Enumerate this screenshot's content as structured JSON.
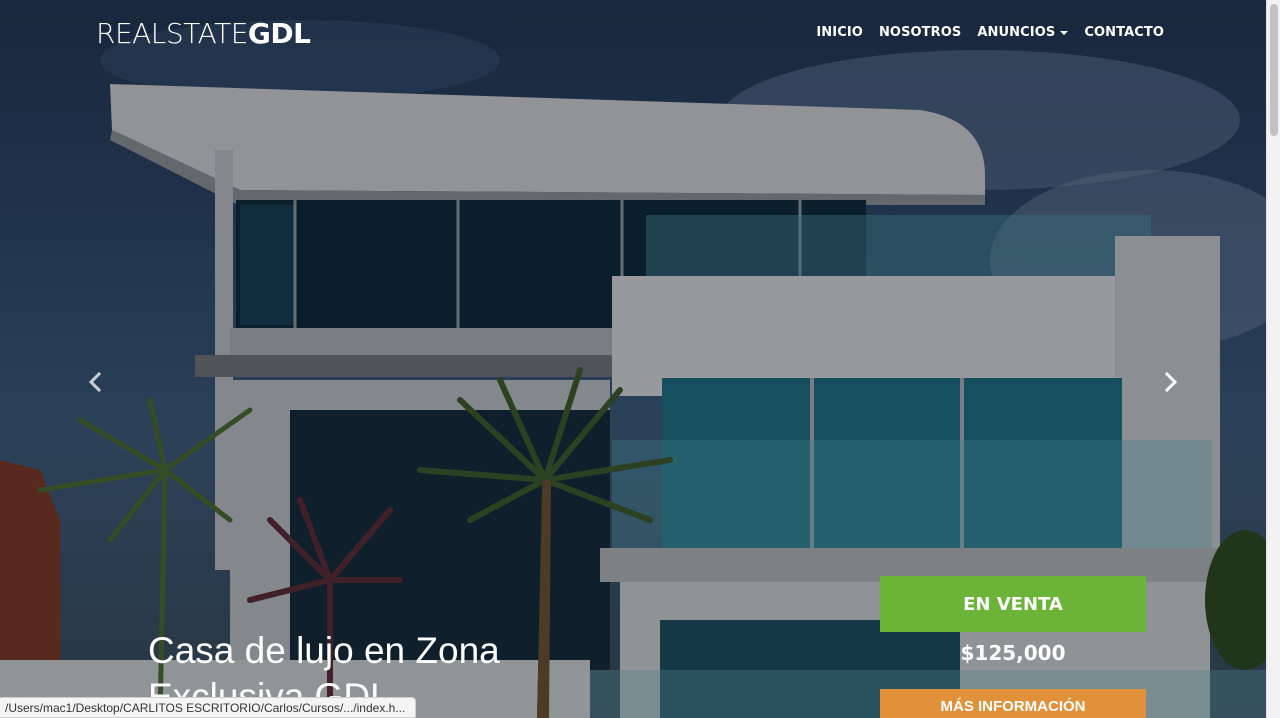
{
  "brand": {
    "light": "REALSTATE",
    "bold": "GDL"
  },
  "nav": {
    "items": [
      {
        "label": "INICIO"
      },
      {
        "label": "NOSOTROS"
      },
      {
        "label": "ANUNCIOS",
        "dropdown": true
      },
      {
        "label": "CONTACTO"
      }
    ]
  },
  "carousel": {
    "prev_icon": "chevron-left-icon",
    "next_icon": "chevron-right-icon",
    "caption": "Casa de lujo en Zona Exclusiva GDL"
  },
  "listing": {
    "status": "EN VENTA",
    "price": "$125,000",
    "button": "MÁS INFORMACIÓN"
  },
  "status_bar": {
    "url": "/Users/mac1/Desktop/CARLITOS ESCRITORIO/Carlos/Cursos/.../index.h..."
  },
  "colors": {
    "sale_green": "#6bb437",
    "info_orange": "#e1913a",
    "text": "#ffffff"
  }
}
